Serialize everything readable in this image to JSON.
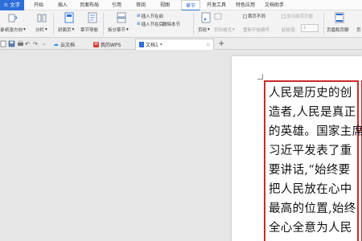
{
  "menubar": {
    "app_button": "≡ 文字",
    "tabs": [
      "开始",
      "插入",
      "页面布局",
      "引用",
      "审阅",
      "视图",
      "章节",
      "开发工具",
      "特色应用",
      "文档助手"
    ],
    "active_tab": "章节"
  },
  "ribbon": {
    "catalog": "录",
    "paper_direction": "纸张方向",
    "columns": "分栏",
    "cover_page": "封面页",
    "chapter_nav": "章节导航",
    "split_chapter": "拆分章节",
    "insert_section_before": "插入节在前",
    "insert_section_after": "插入节在后",
    "delete_section": "删除本节",
    "header_footer": "页码",
    "page_number_format": "页码格式",
    "first_page_diff": "首页不同",
    "show_prev_header": "显示前页页眉",
    "restart_numbering": "重新开始编号",
    "start_value_label": "起始值:",
    "start_value": "1",
    "header_footer_btn": "页眉和页脚",
    "last_btn": "页"
  },
  "toolbar": {
    "tabs": [
      {
        "label": "云文档"
      },
      {
        "label": "我的WPS"
      },
      {
        "label": "文档1 *"
      }
    ],
    "add_tab": "+"
  },
  "document": {
    "lines": [
      "人民是历史的创",
      "造者,人民是真正",
      "的英雄。国家主席",
      "习近平发表了重",
      "要讲话,“始终要",
      "把人民放在心中",
      "最高的位置,始终",
      "全心全意为人民"
    ]
  },
  "colors": {
    "accent": "#2d6fd8",
    "textbox_border": "#cc2a2a"
  }
}
